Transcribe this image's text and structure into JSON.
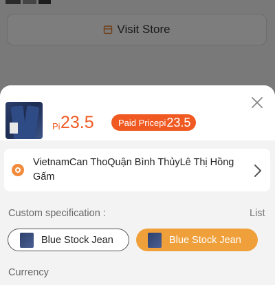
{
  "background": {
    "visit_store_label": "Visit Store",
    "accent": "#f05a22"
  },
  "sheet": {
    "price_symbol": "Pi",
    "price": "23.5",
    "paid_badge": {
      "label": "Paid Pricepi",
      "amount": "23.5"
    },
    "address": "VietnamCan ThoQuận Bình ThủyLê Thị Hồng Gấm",
    "spec_label": "Custom specification :",
    "list_label": "List",
    "options": [
      {
        "label": "Blue Stock Jean",
        "selected": false
      },
      {
        "label": "Blue Stock Jean",
        "selected": true
      }
    ],
    "currency_label": "Currency"
  },
  "icons": {
    "store": "store-icon",
    "close": "close-icon",
    "location": "location-pin-icon",
    "chevron": "chevron-right-icon"
  }
}
